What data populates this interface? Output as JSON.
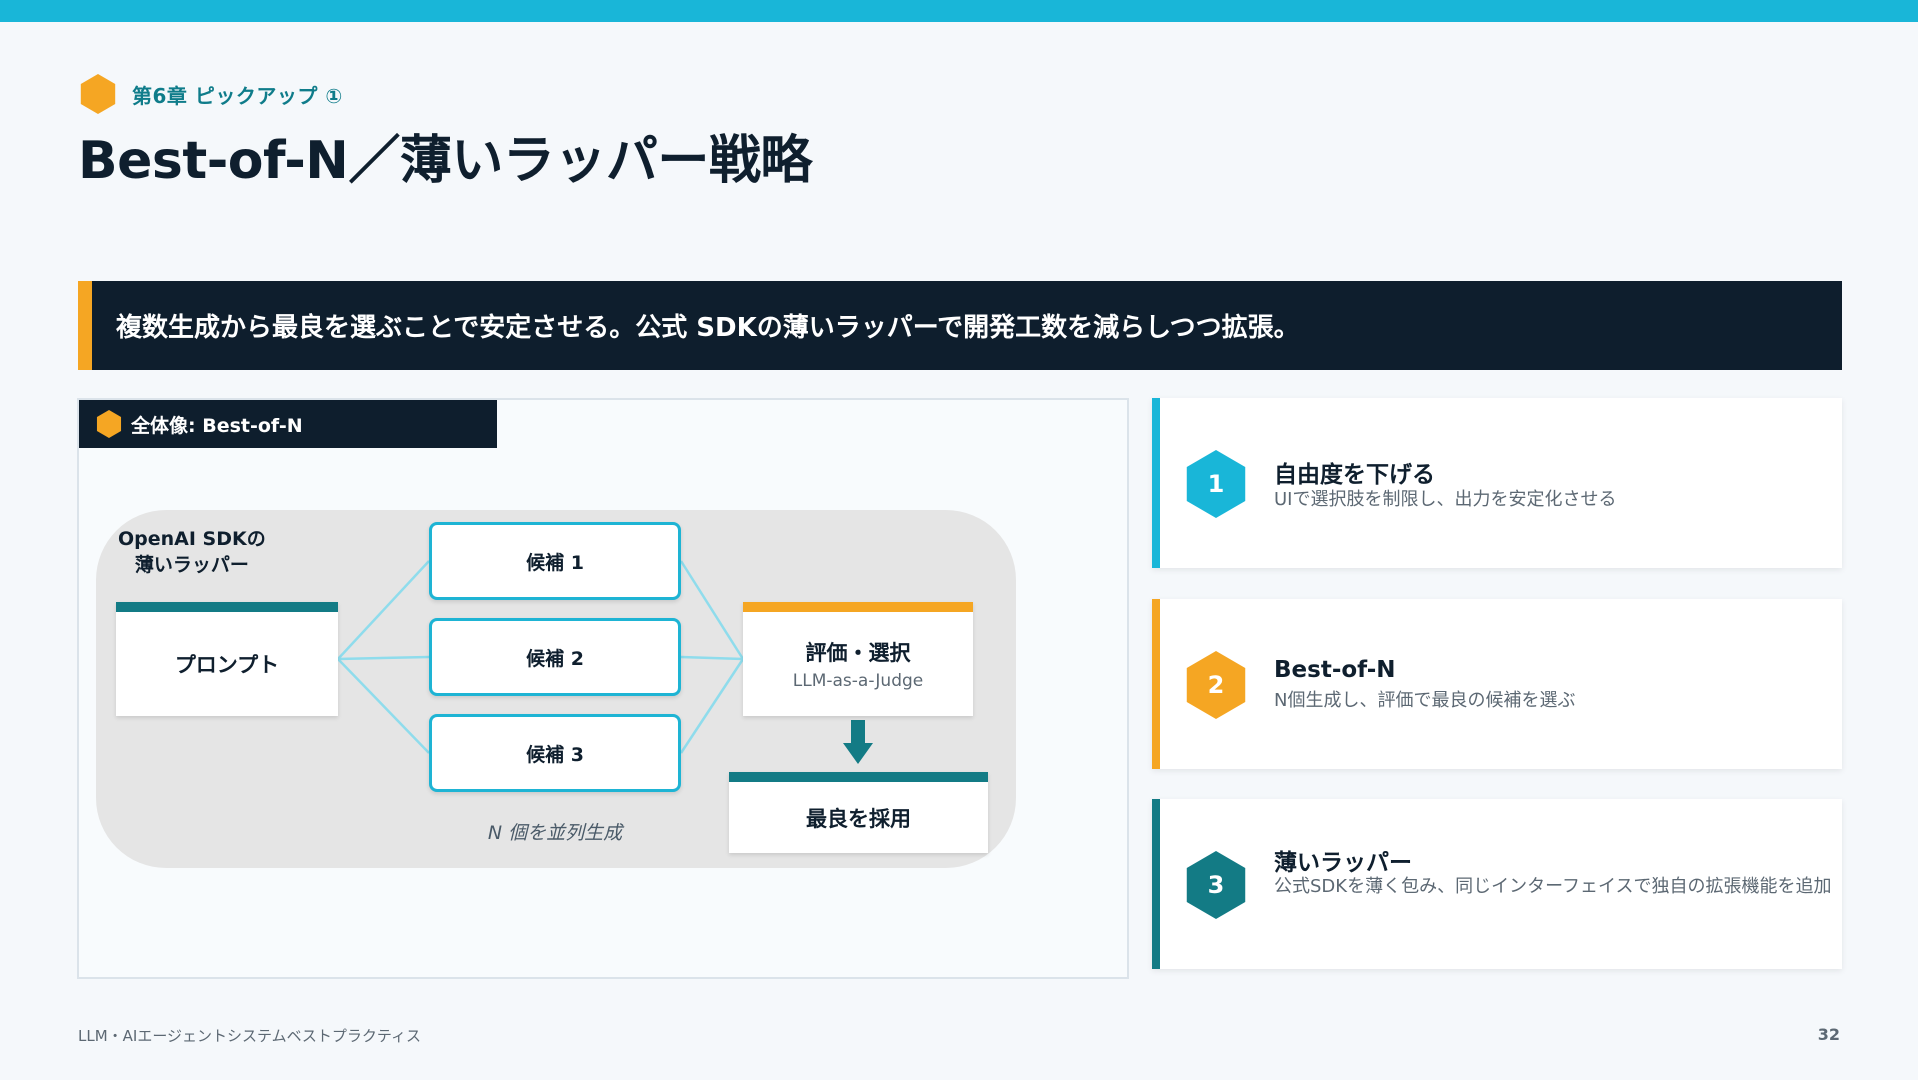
{
  "colors": {
    "accent_cyan": "#19b6d8",
    "accent_orange": "#f5a623",
    "accent_teal": "#137b85",
    "dark_navy": "#0e1e2d"
  },
  "header": {
    "chapter_label": "第6章 ピックアップ ①",
    "title": "Best-of-N／薄いラッパー戦略"
  },
  "banner": {
    "text": "複数生成から最良を選ぶことで安定させる。公式 SDKの薄いラッパーで開発工数を減らしつつ拡張。"
  },
  "diagram": {
    "panel_title": "全体像: Best-of-N",
    "wrapper_label_line1": "OpenAI SDKの",
    "wrapper_label_line2": "薄いラッパー",
    "prompt": "プロンプト",
    "candidates": [
      "候補 1",
      "候補 2",
      "候補 3"
    ],
    "n_caption": "N 個を並列生成",
    "eval_title": "評価・選択",
    "eval_sub": "LLM-as-a-Judge",
    "best": "最良を採用"
  },
  "cards": [
    {
      "number": "1",
      "icon": "hexagon",
      "title": "自由度を下げる",
      "desc": "UIで選択肢を制限し、出力を安定化させる"
    },
    {
      "number": "2",
      "icon": "hexagon",
      "title": "Best-of-N",
      "desc": "N個生成し、評価で最良の候補を選ぶ"
    },
    {
      "number": "3",
      "icon": "hexagon",
      "title": "薄いラッパー",
      "desc": "公式SDKを薄く包み、同じインターフェイスで独自の拡張機能を追加"
    }
  ],
  "footer": {
    "text": "LLM・AIエージェントシステムベストプラクティス",
    "page_number": "32"
  }
}
